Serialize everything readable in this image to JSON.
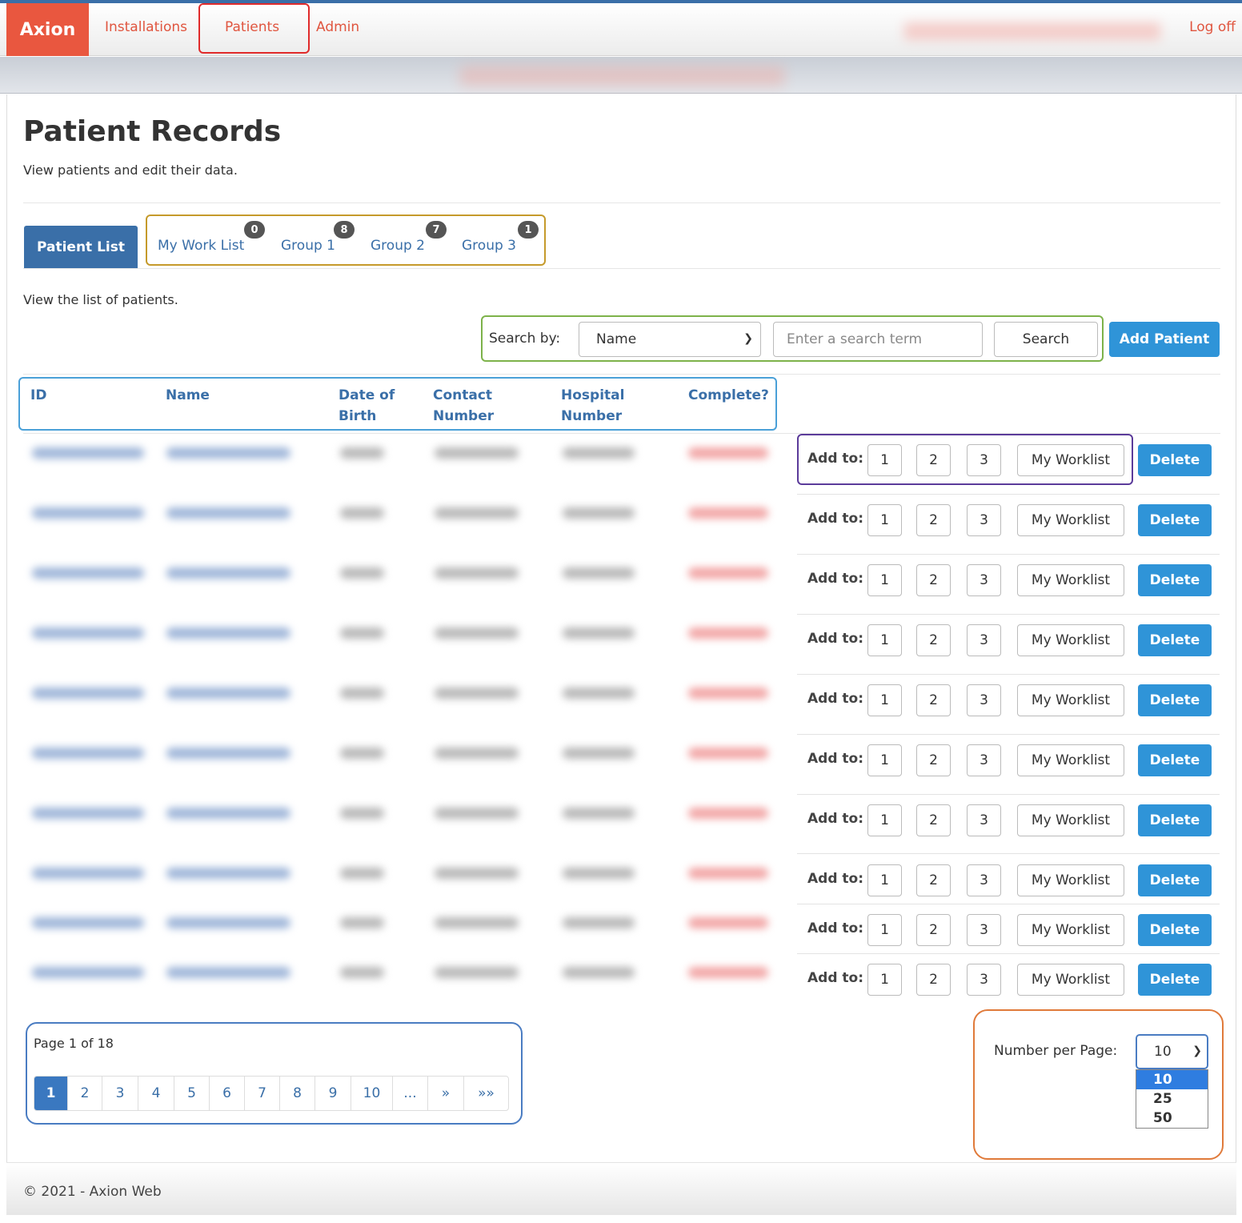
{
  "nav": {
    "brand": "Axion",
    "links": [
      "Installations",
      "Patients",
      "Admin"
    ],
    "logoff": "Log off"
  },
  "page": {
    "title": "Patient Records",
    "subtitle": "View patients and edit their data."
  },
  "tabs": {
    "active": "Patient List",
    "items": [
      {
        "label": "My Work List",
        "badge": "0"
      },
      {
        "label": "Group 1",
        "badge": "8"
      },
      {
        "label": "Group 2",
        "badge": "7"
      },
      {
        "label": "Group 3",
        "badge": "1"
      }
    ]
  },
  "list_intro": "View the list of patients.",
  "search": {
    "label": "Search by:",
    "field_value": "Name",
    "placeholder": "Enter a search term",
    "button": "Search",
    "add_button": "Add Patient"
  },
  "table": {
    "columns": [
      "ID",
      "Name",
      "Date of Birth",
      "Contact Number",
      "Hospital Number",
      "Complete?"
    ],
    "row_actions": {
      "add_to": "Add to:",
      "groups": [
        "1",
        "2",
        "3"
      ],
      "worklist": "My Worklist",
      "delete": "Delete"
    },
    "row_count": 10
  },
  "pagination": {
    "info": "Page 1 of 18",
    "pages": [
      "1",
      "2",
      "3",
      "4",
      "5",
      "6",
      "7",
      "8",
      "9",
      "10",
      "...",
      "»",
      "»»"
    ],
    "current": "1"
  },
  "per_page": {
    "label": "Number per Page:",
    "value": "10",
    "options": [
      "10",
      "25",
      "50"
    ]
  },
  "footer": "© 2021 - Axion Web",
  "colors": {
    "brand": "#e9573f",
    "primary": "#3a6fa8",
    "button_blue": "#2f94d8"
  }
}
